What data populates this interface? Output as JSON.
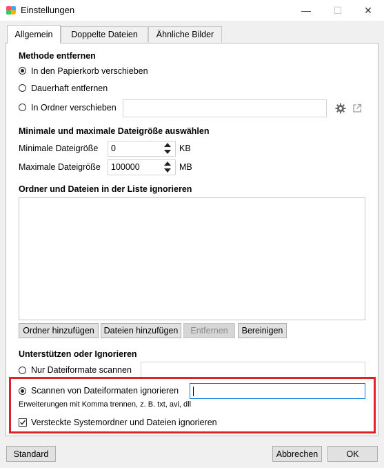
{
  "window": {
    "title": "Einstellungen"
  },
  "tabs": [
    "Allgemein",
    "Doppelte Dateien",
    "Ähnliche Bilder"
  ],
  "remove_method": {
    "title": "Methode entfernen",
    "options": [
      "In den Papierkorb verschieben",
      "Dauerhaft entfernen",
      "In Ordner verschieben"
    ],
    "selected": 0,
    "folder_path": ""
  },
  "size": {
    "title": "Minimale und maximale Dateigröße auswählen",
    "min_label": "Minimale Dateigröße",
    "min_value": "0",
    "min_unit": "KB",
    "max_label": "Maximale Dateigröße",
    "max_value": "100000",
    "max_unit": "MB"
  },
  "ignore_list": {
    "title": "Ordner und Dateien in der Liste ignorieren",
    "items": [],
    "buttons": {
      "add_folder": "Ordner hinzufügen",
      "add_files": "Dateien hinzufügen",
      "remove": "Entfernen",
      "clear": "Bereinigen"
    }
  },
  "formats": {
    "title": "Unterstützen oder Ignorieren",
    "only_scan": "Nur Dateiformate scannen",
    "only_scan_value": "",
    "ignore_scan": "Scannen von Dateiformaten ignorieren",
    "ignore_scan_value": "",
    "hint": "Erweiterungen mit Komma trennen, z. B. txt, avi, dll",
    "selected": 1,
    "hidden_system": "Versteckte Systemordner und Dateien ignorieren",
    "hidden_system_checked": true
  },
  "footer": {
    "standard": "Standard",
    "cancel": "Abbrechen",
    "ok": "OK"
  },
  "colors": {
    "highlight": "#e0202a",
    "focus": "#0078d7"
  }
}
